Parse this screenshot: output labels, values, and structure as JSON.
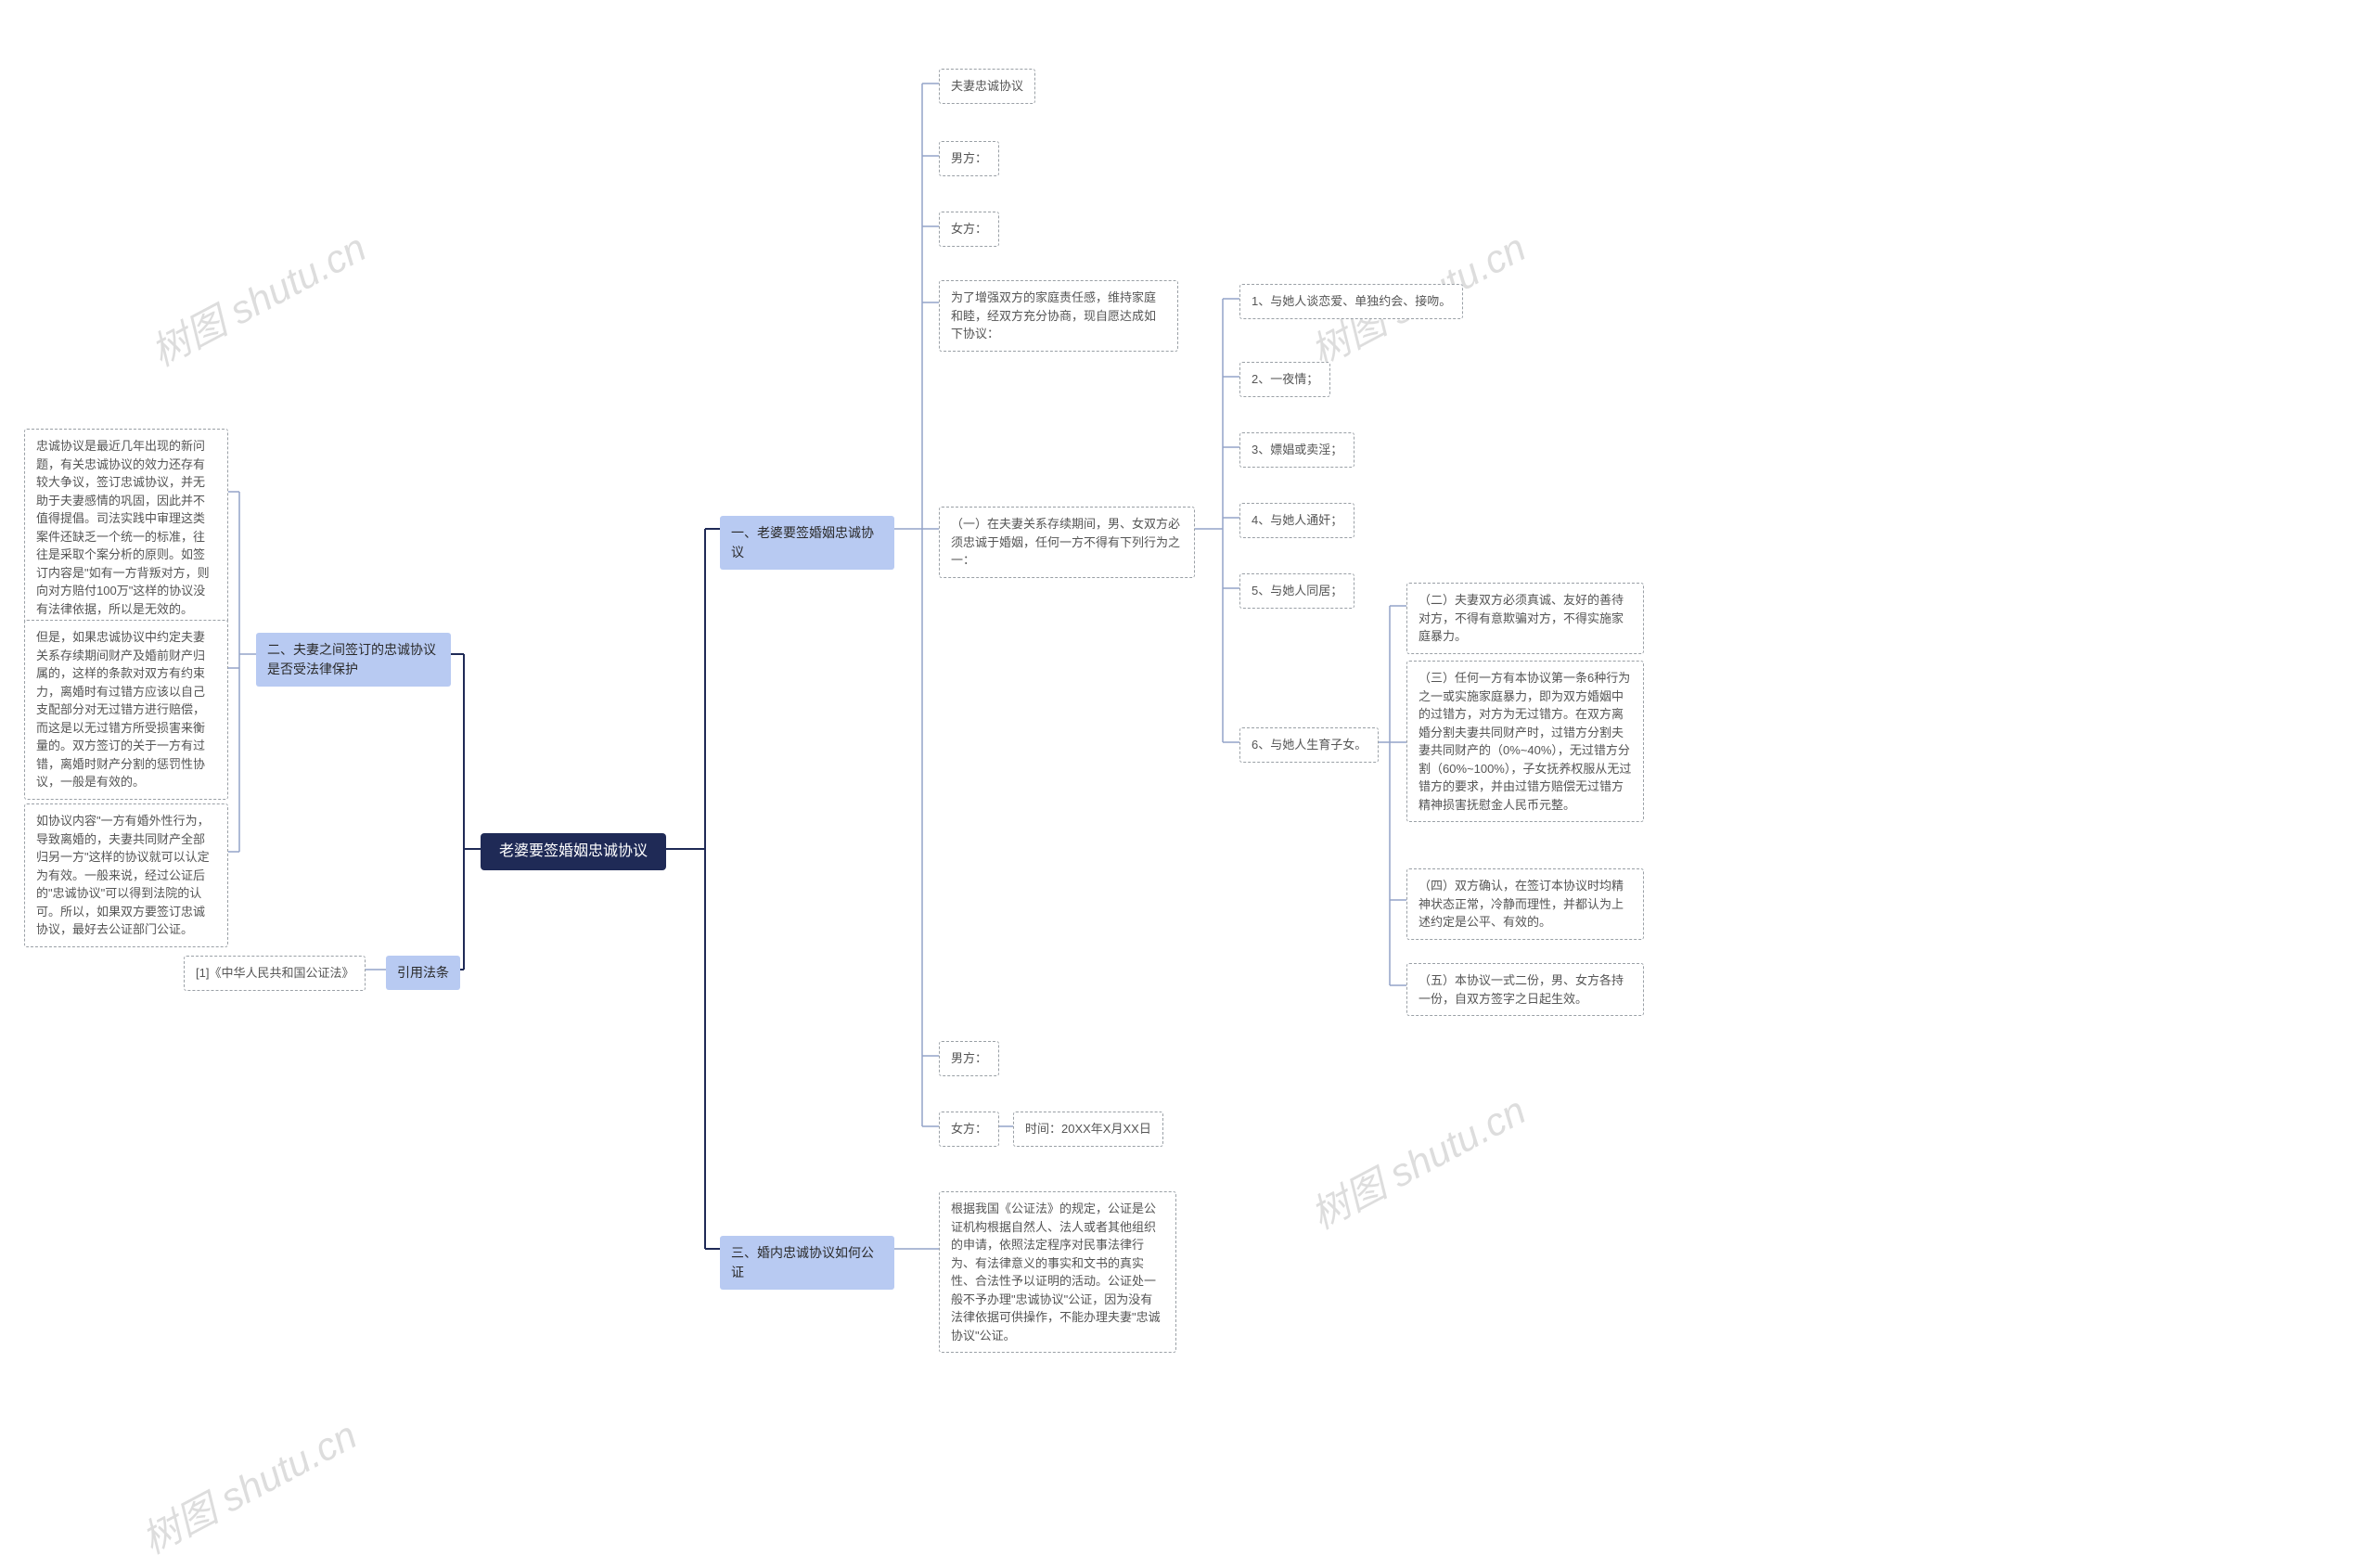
{
  "root": "老婆要签婚姻忠诚协议",
  "branch1": {
    "title": "一、老婆要签婚姻忠诚协议",
    "leaf_a": "夫妻忠诚协议",
    "leaf_b": "男方：",
    "leaf_c": "女方：",
    "leaf_d": "为了增强双方的家庭责任感，维持家庭和睦，经双方充分协商，现自愿达成如下协议：",
    "leaf_e": "（一）在夫妻关系存续期间，男、女双方必须忠诚于婚姻，任何一方不得有下列行为之一：",
    "sub_e": {
      "i1": "1、与她人谈恋爱、单独约会、接吻。",
      "i2": "2、一夜情；",
      "i3": "3、嫖娼或卖淫；",
      "i4": "4、与她人通奸；",
      "i5": "5、与她人同居；",
      "i6": "6、与她人生育子女。",
      "sub_i6": {
        "n2": "（二）夫妻双方必须真诚、友好的善待对方，不得有意欺骗对方，不得实施家庭暴力。",
        "n3": "（三）任何一方有本协议第一条6种行为之一或实施家庭暴力，即为双方婚姻中的过错方，对方为无过错方。在双方离婚分割夫妻共同财产时，过错方分割夫妻共同财产的（0%~40%），无过错方分割（60%~100%），子女抚养权服从无过错方的要求，并由过错方赔偿无过错方精神损害抚慰金人民币元整。",
        "n4": "（四）双方确认，在签订本协议时均精神状态正常，冷静而理性，并都认为上述约定是公平、有效的。",
        "n5": "（五）本协议一式二份，男、女方各持一份，自双方签字之日起生效。"
      }
    },
    "leaf_f": "男方：",
    "leaf_g": "女方：",
    "leaf_g_time": "时间：20XX年X月XX日"
  },
  "branch2": {
    "title": "二、夫妻之间签订的忠诚协议是否受法律保护",
    "leaf_a": "忠诚协议是最近几年出现的新问题，有关忠诚协议的效力还存有较大争议，签订忠诚协议，并无助于夫妻感情的巩固，因此并不值得提倡。司法实践中审理这类案件还缺乏一个统一的标准，往往是采取个案分析的原则。如签订内容是\"如有一方背叛对方，则向对方赔付100万\"这样的协议没有法律依据，所以是无效的。",
    "leaf_b": "但是，如果忠诚协议中约定夫妻关系存续期间财产及婚前财产归属的，这样的条款对双方有约束力，离婚时有过错方应该以自己支配部分对无过错方进行赔偿，而这是以无过错方所受损害来衡量的。双方签订的关于一方有过错，离婚时财产分割的惩罚性协议，一般是有效的。",
    "leaf_c": "如协议内容\"一方有婚外性行为，导致离婚的，夫妻共同财产全部归另一方\"这样的协议就可以认定为有效。一般来说，经过公证后的\"忠诚协议\"可以得到法院的认可。所以，如果双方要签订忠诚协议，最好去公证部门公证。"
  },
  "branch3": {
    "title": "三、婚内忠诚协议如何公证",
    "leaf_a": "根据我国《公证法》的规定，公证是公证机构根据自然人、法人或者其他组织的申请，依照法定程序对民事法律行为、有法律意义的事实和文书的真实性、合法性予以证明的活动。公证处一般不予办理\"忠诚协议\"公证，因为没有法律依据可供操作，不能办理夫妻\"忠诚协议\"公证。"
  },
  "branch_ref": {
    "title": "引用法条",
    "leaf_a": "[1]《中华人民共和国公证法》"
  },
  "watermark": "树图 shutu.cn"
}
